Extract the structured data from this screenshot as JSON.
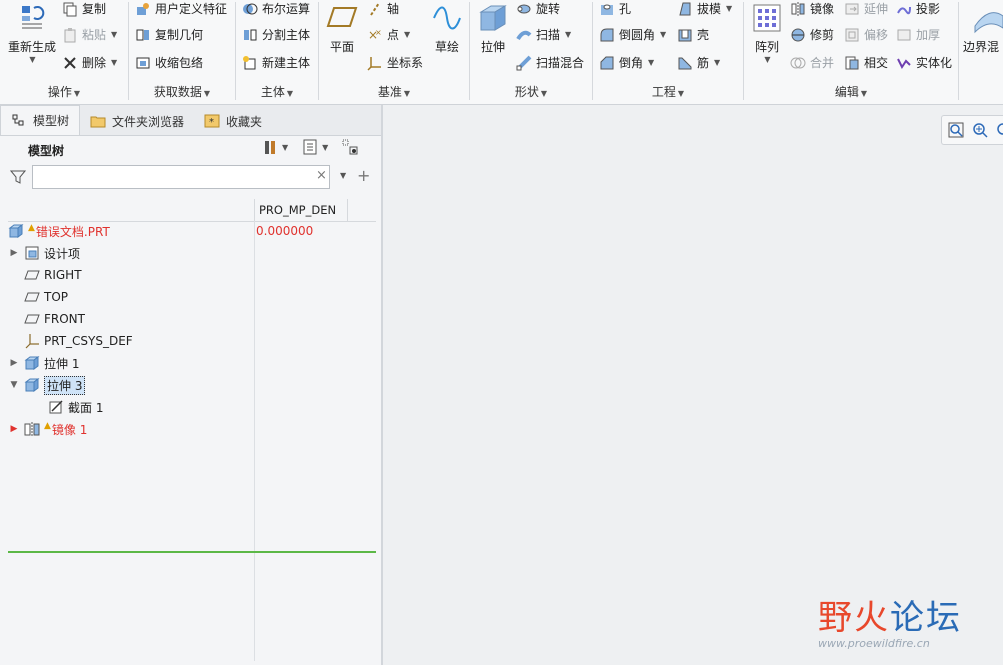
{
  "ribbon": {
    "groups": {
      "operation": {
        "label": "操作",
        "regenerate": "重新生成",
        "copy": "复制",
        "paste": "粘贴",
        "delete": "删除"
      },
      "get_data": {
        "label": "获取数据",
        "user_defined": "用户定义特征",
        "copy_geometry": "复制几何",
        "shrinkwrap": "收缩包络"
      },
      "body": {
        "label": "主体",
        "boolean": "布尔运算",
        "split_body": "分割主体",
        "new_body": "新建主体"
      },
      "datum": {
        "label": "基准",
        "plane": "平面",
        "axis": "轴",
        "point": "点",
        "csys": "坐标系",
        "sketch": "草绘"
      },
      "shapes": {
        "label": "形状",
        "extrude": "拉伸",
        "revolve": "旋转",
        "sweep": "扫描",
        "swept_blend": "扫描混合"
      },
      "engineering": {
        "label": "工程",
        "hole": "孔",
        "round": "倒圆角",
        "chamfer": "倒角",
        "draft": "拔模",
        "shell": "壳",
        "rib": "筋"
      },
      "editing": {
        "label": "编辑",
        "pattern": "阵列",
        "mirror": "镜像",
        "trim": "修剪",
        "merge": "合并",
        "extend": "延伸",
        "offset": "偏移",
        "intersect": "相交",
        "project": "投影",
        "thicken": "加厚",
        "solidify": "实体化"
      },
      "surfaces": {
        "boundary_blend": "边界混"
      }
    }
  },
  "left_panel": {
    "tabs": [
      "模型树",
      "文件夹浏览器",
      "收藏夹"
    ],
    "title": "模型树",
    "search_placeholder": "",
    "column_header": "PRO_MP_DEN",
    "tree": [
      {
        "label": "错误文档.PRT",
        "value": "0.000000",
        "icon": "part-icon",
        "warning": true,
        "error": true
      },
      {
        "label": "设计项",
        "icon": "design-items-icon",
        "expand": "collapsed"
      },
      {
        "label": "RIGHT",
        "icon": "datum-plane-icon"
      },
      {
        "label": "TOP",
        "icon": "datum-plane-icon"
      },
      {
        "label": "FRONT",
        "icon": "datum-plane-icon"
      },
      {
        "label": "PRT_CSYS_DEF",
        "icon": "csys-icon"
      },
      {
        "label": "拉伸 1",
        "icon": "extrude-icon",
        "expand": "collapsed"
      },
      {
        "label": "拉伸 3",
        "icon": "extrude-icon",
        "expand": "expanded",
        "selected": true
      },
      {
        "label": "截面 1",
        "icon": "section-icon",
        "indent": 1
      },
      {
        "label": "镜像 1",
        "icon": "mirror-icon",
        "expand": "collapsed",
        "warning": true,
        "error": true
      }
    ]
  },
  "watermark": {
    "title": "野火论坛",
    "url": "www.proewildfire.cn"
  },
  "colors": {
    "error_red": "#e0322e",
    "warning_yellow": "#e0a000",
    "insert_green": "#5cb847",
    "selection_blue": "#cfe3f7"
  }
}
